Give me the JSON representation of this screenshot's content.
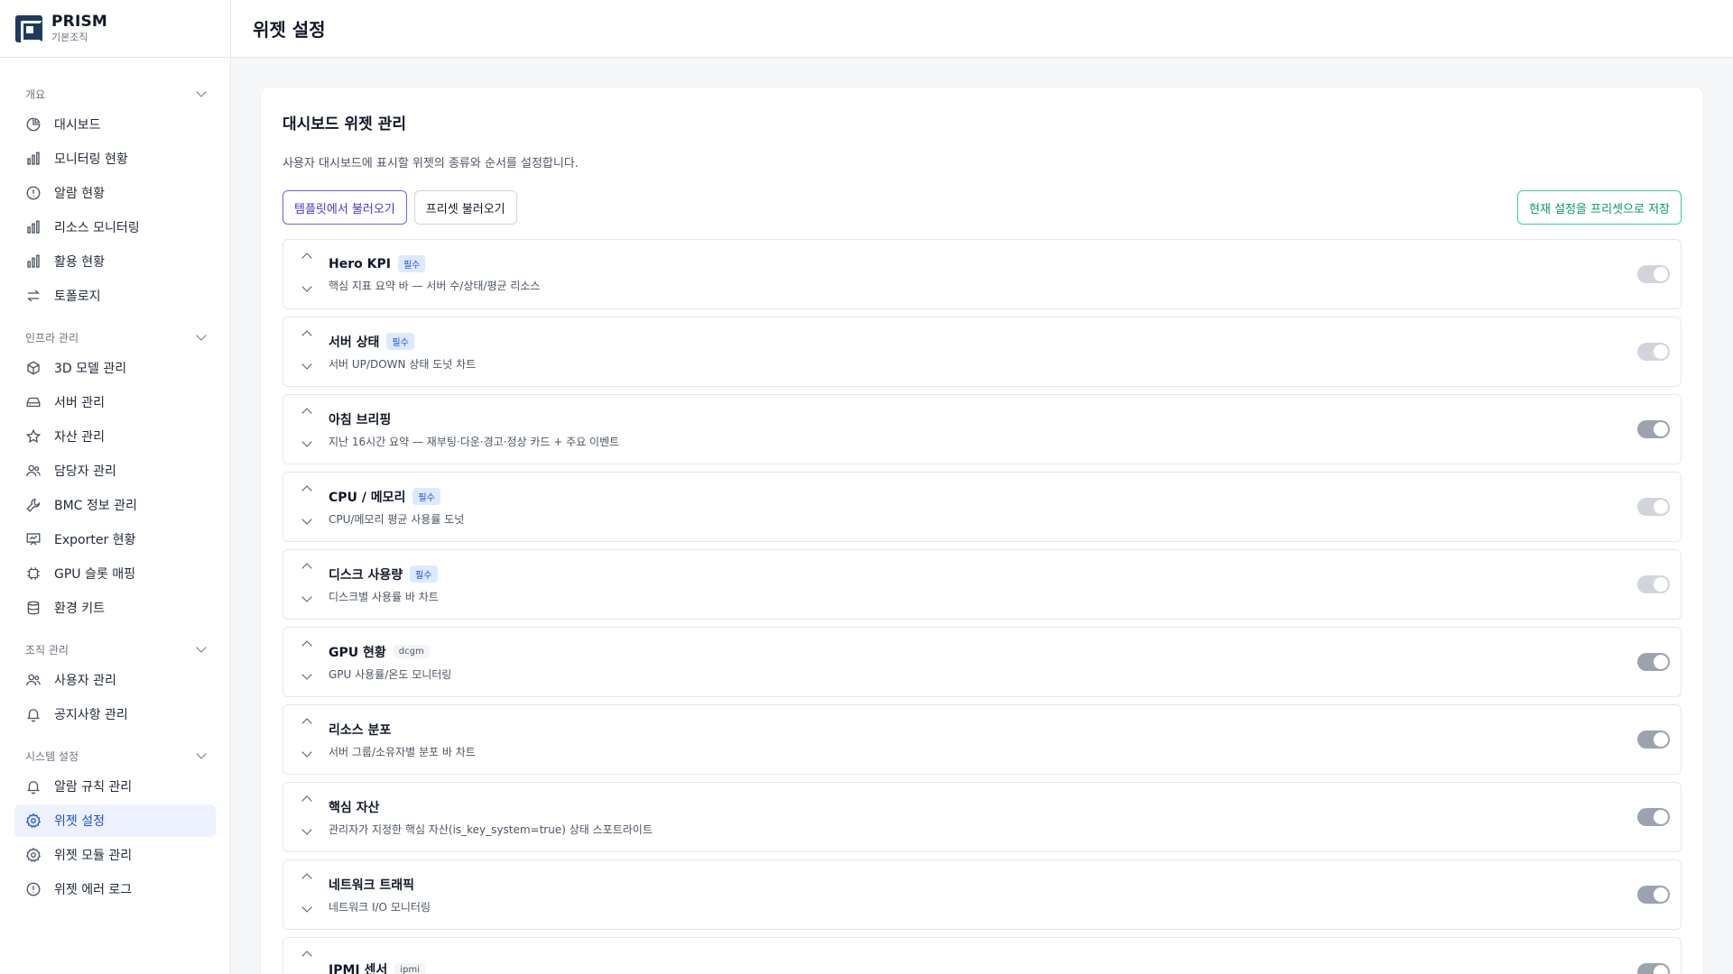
{
  "brand": {
    "name": "PRISM",
    "sub": "기본조직"
  },
  "header": {
    "title": "위젯 설정"
  },
  "sidebar": {
    "sections": [
      {
        "label": "개요",
        "items": [
          {
            "label": "대시보드",
            "icon": "pie-chart-icon"
          },
          {
            "label": "모니터링 현황",
            "icon": "bar-chart-icon"
          },
          {
            "label": "알람 현황",
            "icon": "alert-circle-icon"
          },
          {
            "label": "리소스 모니터링",
            "icon": "bar-chart-icon"
          },
          {
            "label": "활용 현황",
            "icon": "bar-chart-icon"
          },
          {
            "label": "토폴로지",
            "icon": "swap-arrows-icon"
          }
        ]
      },
      {
        "label": "인프라 관리",
        "items": [
          {
            "label": "3D 모델 관리",
            "icon": "cube-icon"
          },
          {
            "label": "서버 관리",
            "icon": "hard-drive-icon"
          },
          {
            "label": "자산 관리",
            "icon": "star-icon"
          },
          {
            "label": "담당자 관리",
            "icon": "users-icon"
          },
          {
            "label": "BMC 정보 관리",
            "icon": "wrench-icon"
          },
          {
            "label": "Exporter 현황",
            "icon": "presentation-icon"
          },
          {
            "label": "GPU 슬롯 매핑",
            "icon": "chip-icon"
          },
          {
            "label": "환경 키트",
            "icon": "database-icon"
          }
        ]
      },
      {
        "label": "조직 관리",
        "items": [
          {
            "label": "사용자 관리",
            "icon": "users-icon"
          },
          {
            "label": "공지사항 관리",
            "icon": "bell-icon"
          }
        ]
      },
      {
        "label": "시스템 설정",
        "items": [
          {
            "label": "알람 규칙 관리",
            "icon": "bell-icon"
          },
          {
            "label": "위젯 설정",
            "icon": "gear-icon",
            "active": true
          },
          {
            "label": "위젯 모듈 관리",
            "icon": "gear-icon"
          },
          {
            "label": "위젯 에러 로그",
            "icon": "alert-circle-icon"
          }
        ]
      }
    ]
  },
  "card": {
    "title": "대시보드 위젯 관리",
    "desc": "사용자 대시보드에 표시할 위젯의 종류와 순서를 설정합니다.",
    "btn_template": "템플릿에서 불러오기",
    "btn_preset": "프리셋 불러오기",
    "btn_save_preset": "현재 설정을 프리셋으로 저장"
  },
  "widgets": [
    {
      "title": "Hero KPI",
      "badge": "필수",
      "badge_type": "required",
      "desc": "핵심 지표 요약 바 — 서버 수/상태/평균 리소스",
      "toggle_disabled": true
    },
    {
      "title": "서버 상태",
      "badge": "필수",
      "badge_type": "required",
      "desc": "서버 UP/DOWN 상태 도넛 차트",
      "toggle_disabled": true
    },
    {
      "title": "아침 브리핑",
      "badge": "",
      "badge_type": "",
      "desc": "지난 16시간 요약 — 재부팅·다운·경고·정상 카드 + 주요 이벤트",
      "toggle_disabled": false
    },
    {
      "title": "CPU / 메모리",
      "badge": "필수",
      "badge_type": "required",
      "desc": "CPU/메모리 평균 사용률 도넛",
      "toggle_disabled": true
    },
    {
      "title": "디스크 사용량",
      "badge": "필수",
      "badge_type": "required",
      "desc": "디스크별 사용률 바 차트",
      "toggle_disabled": true
    },
    {
      "title": "GPU 현황",
      "badge": "dcgm",
      "badge_type": "tag",
      "desc": "GPU 사용률/온도 모니터링",
      "toggle_disabled": false
    },
    {
      "title": "리소스 분포",
      "badge": "",
      "badge_type": "",
      "desc": "서버 그룹/소유자별 분포 바 차트",
      "toggle_disabled": false
    },
    {
      "title": "핵심 자산",
      "badge": "",
      "badge_type": "",
      "desc": "관리자가 지정한 핵심 자산(is_key_system=true) 상태 스포트라이트",
      "toggle_disabled": false
    },
    {
      "title": "네트워크 트래픽",
      "badge": "",
      "badge_type": "",
      "desc": "네트워크 I/O 모니터링",
      "toggle_disabled": false
    },
    {
      "title": "IPMI 센서",
      "badge": "ipmi",
      "badge_type": "tag",
      "desc": "",
      "toggle_disabled": false
    }
  ]
}
